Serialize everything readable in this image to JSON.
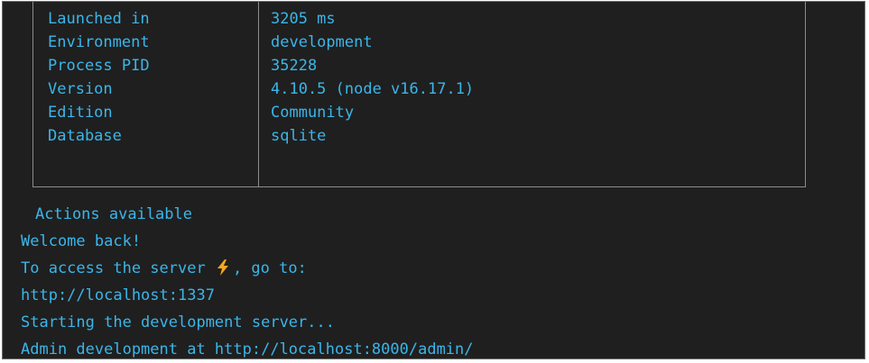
{
  "info_table": {
    "rows": [
      {
        "key": "Launched in",
        "value": "3205 ms"
      },
      {
        "key": "Environment",
        "value": "development"
      },
      {
        "key": "Process PID",
        "value": "35228"
      },
      {
        "key": "Version",
        "value": "4.10.5 (node v16.17.1)"
      },
      {
        "key": "Edition",
        "value": "Community"
      },
      {
        "key": "Database",
        "value": "sqlite"
      }
    ]
  },
  "log": {
    "actions_heading": "Actions available",
    "welcome": "Welcome back!",
    "access_prefix": "To access the server",
    "access_icon": "lightning-bolt-icon",
    "access_suffix": ", go to:",
    "server_url": "http://localhost:1337",
    "starting": "Starting the development server...",
    "admin": "Admin development at http://localhost:8000/admin/"
  },
  "colors": {
    "background": "#1f1f1f",
    "text": "#3ab6ea",
    "border": "#8c8c8c",
    "bolt": "#f5a623"
  }
}
